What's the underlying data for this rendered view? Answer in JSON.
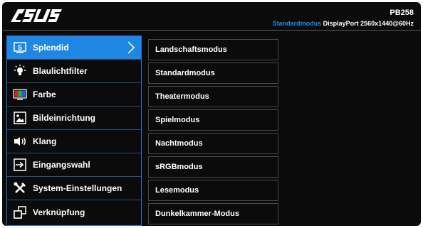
{
  "header": {
    "brand": "ASUS",
    "model": "PB258",
    "mode": "Standardmodus",
    "signal_info": " DisplayPort  2560x1440@60Hz"
  },
  "menu": {
    "items": [
      {
        "label": "Splendid",
        "icon": "splendid-icon",
        "active": true
      },
      {
        "label": "Blaulichtfilter",
        "icon": "bluelight-icon"
      },
      {
        "label": "Farbe",
        "icon": "color-icon"
      },
      {
        "label": "Bildeinrichtung",
        "icon": "image-icon"
      },
      {
        "label": "Klang",
        "icon": "speaker-icon"
      },
      {
        "label": "Eingangswahl",
        "icon": "input-icon"
      },
      {
        "label": "System-Einstellungen",
        "icon": "tools-icon"
      },
      {
        "label": "Verknüpfung",
        "icon": "shortcut-icon"
      }
    ]
  },
  "submenu": {
    "items": [
      "Landschaftsmodus",
      "Standardmodus",
      "Theatermodus",
      "Spielmodus",
      "Nachtmodus",
      "sRGBmodus",
      "Lesemodus",
      "Dunkelkammer-Modus"
    ]
  },
  "colors": {
    "accent": "#1f86e3",
    "background": "#0b0b0b",
    "mode_text": "#1d8fe8"
  }
}
